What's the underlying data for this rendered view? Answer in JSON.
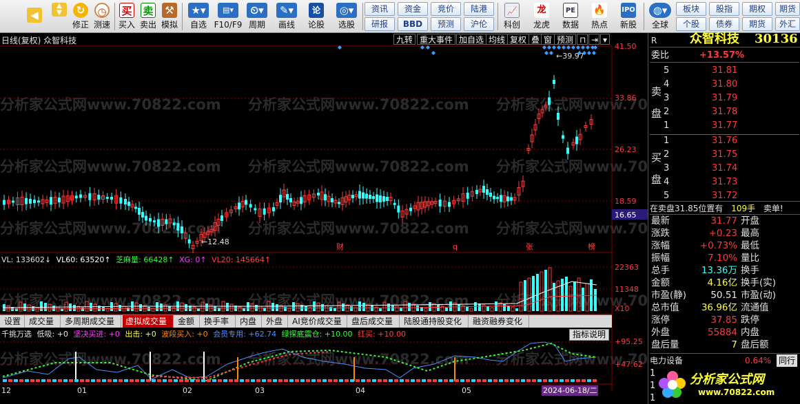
{
  "toolbar": {
    "left_buttons": [
      {
        "label": "",
        "icon": "back-arrow-icon"
      },
      {
        "label": "",
        "icon": "up-down-arrows-icon"
      },
      {
        "label": "修正",
        "icon": "revise-icon"
      },
      {
        "label": "测速",
        "icon": "speed-clock-icon"
      },
      {
        "label": "买入",
        "icon": "buy-icon"
      },
      {
        "label": "卖出",
        "icon": "sell-icon"
      },
      {
        "label": "模拟",
        "icon": "hammer-icon"
      },
      {
        "label": "自选",
        "icon": "star-icon"
      },
      {
        "label": "F10/F9",
        "icon": "f10-icon"
      },
      {
        "label": "周期",
        "icon": "period-icon"
      },
      {
        "label": "画线",
        "icon": "pencil-icon"
      },
      {
        "label": "论股",
        "icon": "forum-icon"
      },
      {
        "label": "选股",
        "icon": "stock-picker-icon"
      }
    ],
    "text_buttons_row1": [
      "资讯",
      "资金",
      "竞价",
      "陆港"
    ],
    "text_buttons_row2": [
      "研报",
      "BBD",
      "预测",
      "沪伦"
    ],
    "right_buttons": [
      {
        "label": "科创",
        "icon": "chart-icon"
      },
      {
        "label": "龙虎",
        "icon": "dragon-icon"
      },
      {
        "label": "数据",
        "icon": "pe-icon"
      },
      {
        "label": "热点",
        "icon": "fire-icon"
      },
      {
        "label": "新股",
        "icon": "ipo-icon"
      },
      {
        "label": "全球",
        "icon": "globe-icon"
      }
    ],
    "right_text_row1": [
      "板块",
      "股指",
      "期权",
      "期货"
    ],
    "right_text_row2": [
      "个股",
      "债券",
      "期货",
      "外汇"
    ]
  },
  "chart_header": {
    "title": "日线(复权) 众智科技",
    "tools": [
      "九转",
      "重大事件",
      "加自选",
      "均线",
      "复权",
      "叠",
      "窗",
      "预测"
    ]
  },
  "watermark": {
    "text": "分析家公式网www.70822.com"
  },
  "main_chart": {
    "price_labels": [
      "41.50",
      "33.86",
      "26.23",
      "18.59"
    ],
    "current_price": "16.65",
    "high_label": "39.97",
    "low_label": "12.48",
    "event_markers": [
      "财",
      "q",
      "张",
      "榜"
    ]
  },
  "volume_chart": {
    "legend": {
      "vl": "VL: 133602↓",
      "vl60": "VL60: 63520↑",
      "zhima": "芝麻量: 66428↑",
      "xg": "XG: 0↑",
      "vl20": "VL20: 145664↑"
    },
    "scale_labels": [
      "22363",
      "11348"
    ],
    "unit": "X10"
  },
  "tabs": [
    "设置",
    "成交量",
    "多周期成交量",
    "虚拟成交量",
    "金额",
    "换手率",
    "内盘",
    "外盘",
    "AI竞价成交量",
    "盘后成交量",
    "陆股通持股变化",
    "融资融券变化"
  ],
  "active_tab": "虚拟成交量",
  "indicator": {
    "legend": {
      "name": "千挑万选",
      "low_buy": "低吸: +0",
      "firm_buy": "坚决买进: +0",
      "exit": "出击: +0",
      "wave_buy": "波段买入: +0",
      "member": "会员专用: +62.74",
      "green": "绿探底震仓: +10.00",
      "red": "红买: +10.00"
    },
    "explain_button": "指标说明",
    "scale_labels": [
      "+95.25",
      "+47.62"
    ]
  },
  "x_axis": {
    "labels": [
      "12",
      "01",
      "02",
      "03",
      "04",
      "05"
    ],
    "cursor_date": "2024-06-18/二"
  },
  "right_panel": {
    "tag": "R",
    "stock_name": "众智科技",
    "stock_code": "30136",
    "weibi_label": "委比",
    "weibi_value": "+13.57%",
    "sell_side_label": "卖\n盘",
    "buy_side_label": "买\n盘",
    "sell_levels": [
      {
        "level": "5",
        "price": "31.81"
      },
      {
        "level": "4",
        "price": "31.80"
      },
      {
        "level": "3",
        "price": "31.79"
      },
      {
        "level": "2",
        "price": "31.78"
      },
      {
        "level": "1",
        "price": "31.77"
      }
    ],
    "buy_levels": [
      {
        "level": "1",
        "price": "31.76"
      },
      {
        "level": "2",
        "price": "31.75"
      },
      {
        "level": "3",
        "price": "31.74"
      },
      {
        "level": "4",
        "price": "31.73"
      },
      {
        "level": "5",
        "price": "31.72"
      }
    ],
    "status_line": "在卖盘31.85位置有",
    "status_volume": "109手",
    "status_type": "卖单!",
    "quote_rows": [
      {
        "l1": "最新",
        "v1": "31.77",
        "l2": "开盘"
      },
      {
        "l1": "涨跌",
        "v1": "+0.23",
        "l2": "最高"
      },
      {
        "l1": "涨幅",
        "v1": "+0.73%",
        "l2": "最低"
      },
      {
        "l1": "振幅",
        "v1": "7.10%",
        "l2": "量比"
      },
      {
        "l1": "总手",
        "v1": "13.36万",
        "l2": "换手"
      },
      {
        "l1": "金额",
        "v1": "4.16亿",
        "l2": "换手(实)"
      },
      {
        "l1": "市盈(静)",
        "v1": "50.51",
        "l2": "市盈(动)"
      },
      {
        "l1": "总市值",
        "v1": "36.96亿",
        "l2": "流通值"
      },
      {
        "l1": "涨停",
        "v1": "37.85",
        "l2": "跌停"
      },
      {
        "l1": "外盘",
        "v1": "55884",
        "l2": "内盘"
      },
      {
        "l1": "盘后量",
        "v1": "7",
        "l2": "盘后额"
      }
    ],
    "sector_name": "电力设备",
    "sector_change": "0.64%",
    "sector_tab": "同行",
    "bottom_levels": [
      "1",
      "1",
      "1"
    ],
    "logo_text": "分析家公式网",
    "logo_url": "www.70822.com"
  },
  "colors": {
    "up": "#ff3a3a",
    "down": "#33ffff",
    "background": "#000000",
    "grid": "#8b0000"
  }
}
